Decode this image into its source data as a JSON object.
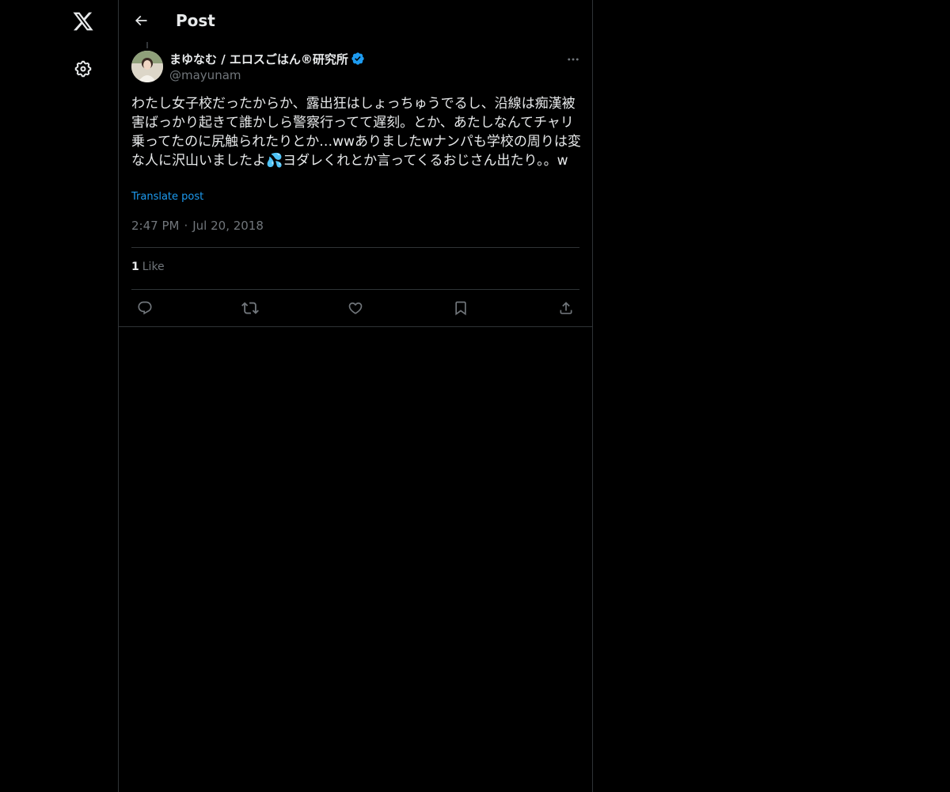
{
  "nav": {
    "logo_icon": "x-logo-icon",
    "settings_icon": "gear-icon"
  },
  "header": {
    "title": "Post"
  },
  "post": {
    "author": {
      "display_name": "まゆなむ / エロスごはん®研究所",
      "handle": "@mayunam",
      "verified": true
    },
    "text": "わたし女子校だったからか、露出狂はしょっちゅうでるし、沿線は痴漢被害ばっかり起きて誰かしら警察行ってて遅刻。とか、あたしなんてチャリ乗ってたのに尻触られたりとか…wwありましたwナンパも学校の周りは変な人に沢山いましたよ💦ヨダレくれとか言ってくるおじさん出たり。。w",
    "translate_label": "Translate post",
    "time": "2:47 PM",
    "separator": "·",
    "date": "Jul 20, 2018",
    "like_count": "1",
    "like_label": "Like"
  },
  "colors": {
    "background": "#000000",
    "text": "#e7e9ea",
    "muted": "#71767b",
    "accent": "#1d9bf0",
    "border": "#2f3336"
  }
}
